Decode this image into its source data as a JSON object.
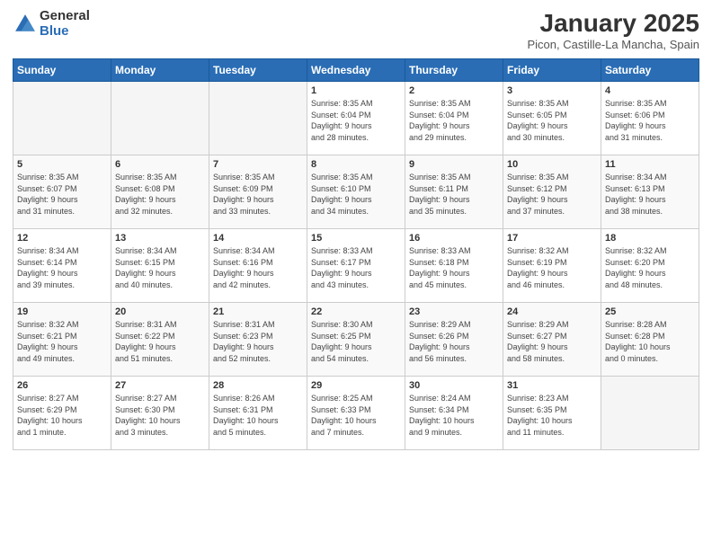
{
  "logo": {
    "general": "General",
    "blue": "Blue"
  },
  "title": "January 2025",
  "subtitle": "Picon, Castille-La Mancha, Spain",
  "days_of_week": [
    "Sunday",
    "Monday",
    "Tuesday",
    "Wednesday",
    "Thursday",
    "Friday",
    "Saturday"
  ],
  "weeks": [
    [
      {
        "day": "",
        "info": ""
      },
      {
        "day": "",
        "info": ""
      },
      {
        "day": "",
        "info": ""
      },
      {
        "day": "1",
        "info": "Sunrise: 8:35 AM\nSunset: 6:04 PM\nDaylight: 9 hours\nand 28 minutes."
      },
      {
        "day": "2",
        "info": "Sunrise: 8:35 AM\nSunset: 6:04 PM\nDaylight: 9 hours\nand 29 minutes."
      },
      {
        "day": "3",
        "info": "Sunrise: 8:35 AM\nSunset: 6:05 PM\nDaylight: 9 hours\nand 30 minutes."
      },
      {
        "day": "4",
        "info": "Sunrise: 8:35 AM\nSunset: 6:06 PM\nDaylight: 9 hours\nand 31 minutes."
      }
    ],
    [
      {
        "day": "5",
        "info": "Sunrise: 8:35 AM\nSunset: 6:07 PM\nDaylight: 9 hours\nand 31 minutes."
      },
      {
        "day": "6",
        "info": "Sunrise: 8:35 AM\nSunset: 6:08 PM\nDaylight: 9 hours\nand 32 minutes."
      },
      {
        "day": "7",
        "info": "Sunrise: 8:35 AM\nSunset: 6:09 PM\nDaylight: 9 hours\nand 33 minutes."
      },
      {
        "day": "8",
        "info": "Sunrise: 8:35 AM\nSunset: 6:10 PM\nDaylight: 9 hours\nand 34 minutes."
      },
      {
        "day": "9",
        "info": "Sunrise: 8:35 AM\nSunset: 6:11 PM\nDaylight: 9 hours\nand 35 minutes."
      },
      {
        "day": "10",
        "info": "Sunrise: 8:35 AM\nSunset: 6:12 PM\nDaylight: 9 hours\nand 37 minutes."
      },
      {
        "day": "11",
        "info": "Sunrise: 8:34 AM\nSunset: 6:13 PM\nDaylight: 9 hours\nand 38 minutes."
      }
    ],
    [
      {
        "day": "12",
        "info": "Sunrise: 8:34 AM\nSunset: 6:14 PM\nDaylight: 9 hours\nand 39 minutes."
      },
      {
        "day": "13",
        "info": "Sunrise: 8:34 AM\nSunset: 6:15 PM\nDaylight: 9 hours\nand 40 minutes."
      },
      {
        "day": "14",
        "info": "Sunrise: 8:34 AM\nSunset: 6:16 PM\nDaylight: 9 hours\nand 42 minutes."
      },
      {
        "day": "15",
        "info": "Sunrise: 8:33 AM\nSunset: 6:17 PM\nDaylight: 9 hours\nand 43 minutes."
      },
      {
        "day": "16",
        "info": "Sunrise: 8:33 AM\nSunset: 6:18 PM\nDaylight: 9 hours\nand 45 minutes."
      },
      {
        "day": "17",
        "info": "Sunrise: 8:32 AM\nSunset: 6:19 PM\nDaylight: 9 hours\nand 46 minutes."
      },
      {
        "day": "18",
        "info": "Sunrise: 8:32 AM\nSunset: 6:20 PM\nDaylight: 9 hours\nand 48 minutes."
      }
    ],
    [
      {
        "day": "19",
        "info": "Sunrise: 8:32 AM\nSunset: 6:21 PM\nDaylight: 9 hours\nand 49 minutes."
      },
      {
        "day": "20",
        "info": "Sunrise: 8:31 AM\nSunset: 6:22 PM\nDaylight: 9 hours\nand 51 minutes."
      },
      {
        "day": "21",
        "info": "Sunrise: 8:31 AM\nSunset: 6:23 PM\nDaylight: 9 hours\nand 52 minutes."
      },
      {
        "day": "22",
        "info": "Sunrise: 8:30 AM\nSunset: 6:25 PM\nDaylight: 9 hours\nand 54 minutes."
      },
      {
        "day": "23",
        "info": "Sunrise: 8:29 AM\nSunset: 6:26 PM\nDaylight: 9 hours\nand 56 minutes."
      },
      {
        "day": "24",
        "info": "Sunrise: 8:29 AM\nSunset: 6:27 PM\nDaylight: 9 hours\nand 58 minutes."
      },
      {
        "day": "25",
        "info": "Sunrise: 8:28 AM\nSunset: 6:28 PM\nDaylight: 10 hours\nand 0 minutes."
      }
    ],
    [
      {
        "day": "26",
        "info": "Sunrise: 8:27 AM\nSunset: 6:29 PM\nDaylight: 10 hours\nand 1 minute."
      },
      {
        "day": "27",
        "info": "Sunrise: 8:27 AM\nSunset: 6:30 PM\nDaylight: 10 hours\nand 3 minutes."
      },
      {
        "day": "28",
        "info": "Sunrise: 8:26 AM\nSunset: 6:31 PM\nDaylight: 10 hours\nand 5 minutes."
      },
      {
        "day": "29",
        "info": "Sunrise: 8:25 AM\nSunset: 6:33 PM\nDaylight: 10 hours\nand 7 minutes."
      },
      {
        "day": "30",
        "info": "Sunrise: 8:24 AM\nSunset: 6:34 PM\nDaylight: 10 hours\nand 9 minutes."
      },
      {
        "day": "31",
        "info": "Sunrise: 8:23 AM\nSunset: 6:35 PM\nDaylight: 10 hours\nand 11 minutes."
      },
      {
        "day": "",
        "info": ""
      }
    ]
  ]
}
